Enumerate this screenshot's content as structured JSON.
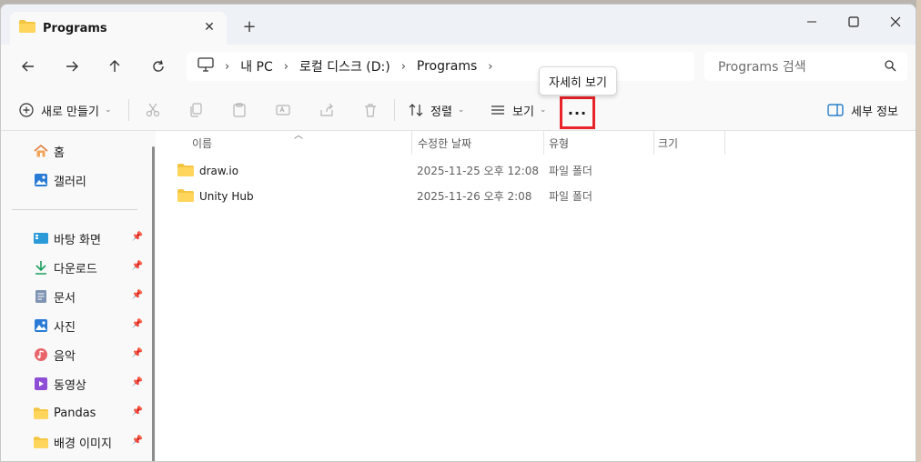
{
  "window": {
    "tab_title": "Programs",
    "tab_close": "✕",
    "new_tab": "+"
  },
  "address": {
    "crumbs": [
      "내 PC",
      "로컬 디스크 (D:)",
      "Programs"
    ],
    "separator": "›",
    "search_placeholder": "Programs 검색"
  },
  "tooltip": {
    "text": "자세히 보기"
  },
  "toolbar": {
    "new_label": "새로 만들기",
    "sort_label": "정렬",
    "view_label": "보기",
    "more_label": "···",
    "details_label": "세부 정보",
    "chevron": "⌄"
  },
  "sidebar": {
    "home": "홈",
    "gallery": "갤러리",
    "pinned": [
      {
        "label": "바탕 화면",
        "icon": "desktop-icon"
      },
      {
        "label": "다운로드",
        "icon": "download-icon"
      },
      {
        "label": "문서",
        "icon": "document-icon"
      },
      {
        "label": "사진",
        "icon": "pictures-icon"
      },
      {
        "label": "음악",
        "icon": "music-icon"
      },
      {
        "label": "동영상",
        "icon": "video-icon"
      },
      {
        "label": "Pandas",
        "icon": "folder-icon"
      },
      {
        "label": "배경 이미지",
        "icon": "folder-icon"
      }
    ]
  },
  "columns": {
    "name": "이름",
    "modified": "수정한 날짜",
    "type": "유형",
    "size": "크기"
  },
  "files": [
    {
      "name": "draw.io",
      "modified": "2025-11-25 오후 12:08",
      "type": "파일 폴더"
    },
    {
      "name": "Unity Hub",
      "modified": "2025-11-26 오후 2:08",
      "type": "파일 폴더"
    }
  ],
  "colors": {
    "highlight_border": "#e8232a",
    "folder": "#f4c542",
    "accent": "#0067c0"
  }
}
